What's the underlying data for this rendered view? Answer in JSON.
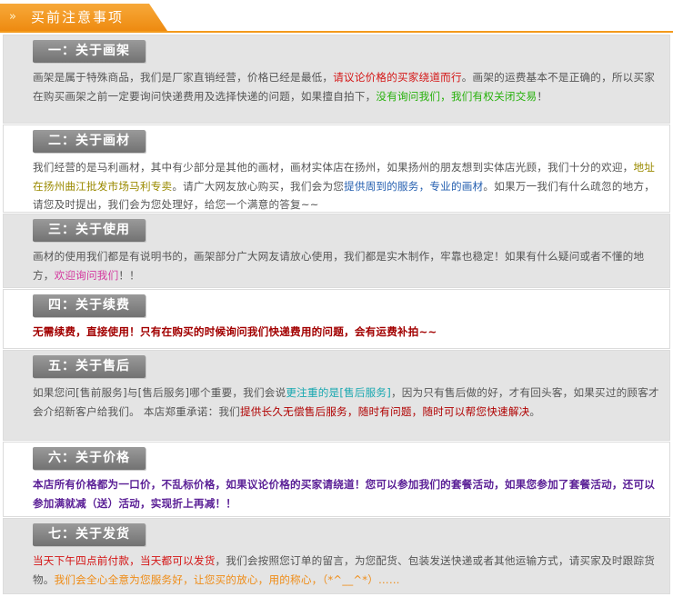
{
  "header": {
    "arrow": "»",
    "title": "买前注意事项"
  },
  "sections": [
    {
      "title": "一：关于画架",
      "parts": [
        {
          "t": "画架是属于特殊商品，我们是厂家直销经营，价格已经是最低，",
          "c": ""
        },
        {
          "t": "请议论价格的买家绕道而行",
          "c": "red"
        },
        {
          "t": "。画架的运费基本不是正确的，所以买家在购买画架之前一定要询问快递费用及选择快递的问题，如果擅自拍下，",
          "c": ""
        },
        {
          "t": "没有询问我们，我们有权关闭交易",
          "c": "green"
        },
        {
          "t": "！",
          "c": ""
        }
      ]
    },
    {
      "title": "二：关于画材",
      "parts": [
        {
          "t": "我们经营的是马利画材，其中有少部分是其他的画材，画材实体店在扬州，如果扬州的朋友想到实体店光顾，我们十分的欢迎，",
          "c": ""
        },
        {
          "t": "地址在扬州曲江批发市场马利专卖",
          "c": "olive"
        },
        {
          "t": "。请广大网友放心购买，我们会为您",
          "c": ""
        },
        {
          "t": "提供周到的服务，专业的画材",
          "c": "blue"
        },
        {
          "t": "。如果万一我们有什么疏忽的地方，请您及时提出，我们会为您处理好，给您一个满意的答复~~",
          "c": ""
        }
      ]
    },
    {
      "title": "三：关于使用",
      "parts": [
        {
          "t": "画材的使用我们都是有说明书的，画架部分广大网友请放心使用，我们都是实木制作，牢靠也稳定！如果有什么疑问或者不懂的地方，",
          "c": ""
        },
        {
          "t": "欢迎询问我们",
          "c": "pink"
        },
        {
          "t": "！！",
          "c": ""
        }
      ]
    },
    {
      "title": "四：关于续费",
      "parts": [
        {
          "t": "无需续费，直接使用！只有在购买的时候询问我们快递费用的问题，会有运费补拍~~",
          "c": "darkred"
        }
      ]
    },
    {
      "title": "五：关于售后",
      "parts": [
        {
          "t": "如果您问[售前服务]与[售后服务]哪个重要，我们会说",
          "c": ""
        },
        {
          "t": "更注重的是[售后服务]",
          "c": "cyan"
        },
        {
          "t": "，因为只有售后做的好，才有回头客，如果买过的顾客才会介绍新客户给我们。  本店郑重承诺：我们",
          "c": ""
        },
        {
          "t": "提供长久无偿售后服务，随时有问题，随时可以帮您快速解决",
          "c": "maroon"
        },
        {
          "t": "。",
          "c": ""
        }
      ]
    },
    {
      "title": "六：关于价格",
      "parts": [
        {
          "t": "本店所有价格都为一口价，不乱标价格，如果议论价格的买家请绕道！您可以参加我们的套餐活动，如果您参加了套餐活动，还可以参加满就减（送）活动，实现折上再减！！",
          "c": "purple"
        }
      ]
    },
    {
      "title": "七：关于发货",
      "parts": [
        {
          "t": "当天下午四点前付款，当天都可以发货",
          "c": "red"
        },
        {
          "t": "，我们会按照您订单的留言，为您配货、包装发送快递或者其他运输方式，请买家及时跟踪货物。",
          "c": ""
        },
        {
          "t": "我们会全心全意为您服务好，让您买的放心，用的称心，（*^__^*）……",
          "c": "orange"
        }
      ]
    }
  ]
}
